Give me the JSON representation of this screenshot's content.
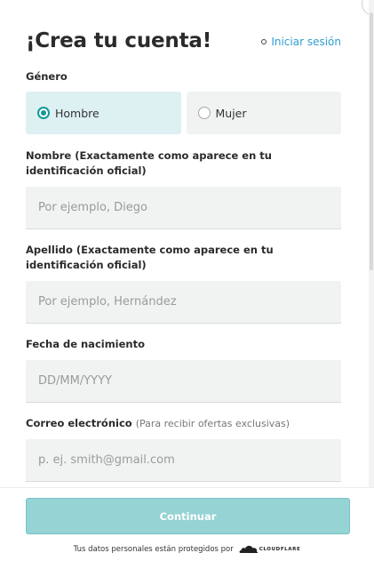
{
  "header": {
    "title": "¡Crea tu cuenta!",
    "login_link": "Iniciar sesión"
  },
  "gender": {
    "label": "Género",
    "options": [
      {
        "label": "Hombre",
        "selected": true
      },
      {
        "label": "Mujer",
        "selected": false
      }
    ]
  },
  "fields": {
    "first_name": {
      "label": "Nombre (Exactamente como aparece en tu identificación oficial)",
      "placeholder": "Por ejemplo, Diego",
      "value": ""
    },
    "last_name": {
      "label": "Apellido (Exactamente como aparece en tu identificación oficial)",
      "placeholder": "Por ejemplo, Hernández",
      "value": ""
    },
    "birthdate": {
      "label": "Fecha de nacimiento",
      "placeholder": "DD/MM/YYYY",
      "value": ""
    },
    "email": {
      "label": "Correo electrónico",
      "hint": "(Para recibir ofertas exclusivas)",
      "placeholder": "p. ej. smith@gmail.com",
      "value": ""
    }
  },
  "footer": {
    "continue_label": "Continuar",
    "protected_text": "Tus datos personales están protegidos por",
    "cloudflare_label": "CLOUDFLARE"
  },
  "colors": {
    "accent": "#139a98",
    "link": "#2e9fd1",
    "button": "#95d3d5"
  }
}
